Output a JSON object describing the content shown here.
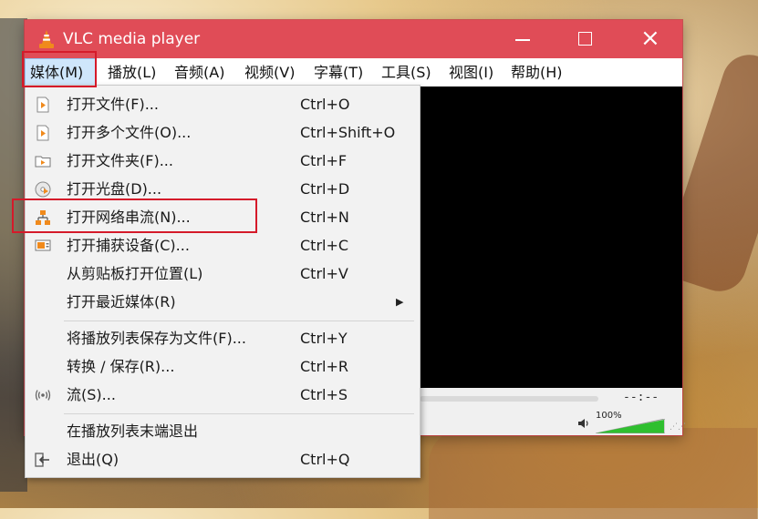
{
  "window": {
    "title": "VLC media player"
  },
  "menubar": {
    "items": [
      {
        "label": "媒体(M)"
      },
      {
        "label": "播放(L)"
      },
      {
        "label": "音频(A)"
      },
      {
        "label": "视频(V)"
      },
      {
        "label": "字幕(T)"
      },
      {
        "label": "工具(S)"
      },
      {
        "label": "视图(I)"
      },
      {
        "label": "帮助(H)"
      }
    ],
    "active_index": 0
  },
  "media_menu": {
    "items": [
      {
        "label": "打开文件(F)...",
        "shortcut": "Ctrl+O",
        "icon": "play-file-icon"
      },
      {
        "label": "打开多个文件(O)...",
        "shortcut": "Ctrl+Shift+O",
        "icon": "play-file-icon"
      },
      {
        "label": "打开文件夹(F)...",
        "shortcut": "Ctrl+F",
        "icon": "folder-icon"
      },
      {
        "label": "打开光盘(D)...",
        "shortcut": "Ctrl+D",
        "icon": "disc-icon"
      },
      {
        "label": "打开网络串流(N)...",
        "shortcut": "Ctrl+N",
        "icon": "network-icon",
        "highlighted": true
      },
      {
        "label": "打开捕获设备(C)...",
        "shortcut": "Ctrl+C",
        "icon": "capture-device-icon"
      },
      {
        "label": "从剪贴板打开位置(L)",
        "shortcut": "Ctrl+V",
        "icon": ""
      },
      {
        "label": "打开最近媒体(R)",
        "shortcut": "",
        "icon": "",
        "submenu": true
      },
      {
        "label": "将播放列表保存为文件(F)...",
        "shortcut": "Ctrl+Y",
        "icon": ""
      },
      {
        "label": "转换 / 保存(R)...",
        "shortcut": "Ctrl+R",
        "icon": ""
      },
      {
        "label": "流(S)...",
        "shortcut": "Ctrl+S",
        "icon": "stream-icon"
      },
      {
        "label": "在播放列表末端退出",
        "shortcut": "",
        "icon": ""
      },
      {
        "label": "退出(Q)",
        "shortcut": "Ctrl+Q",
        "icon": "exit-icon"
      }
    ]
  },
  "player": {
    "time_display": "--:--",
    "volume_label": "100%",
    "volume_level": 1.0
  },
  "colors": {
    "titlebar": "#e04c57",
    "highlight_box": "#d51a2a",
    "menu_bg": "#f2f2f2",
    "volume_green": "#2fbf2f",
    "vlc_orange": "#f08a1c"
  }
}
